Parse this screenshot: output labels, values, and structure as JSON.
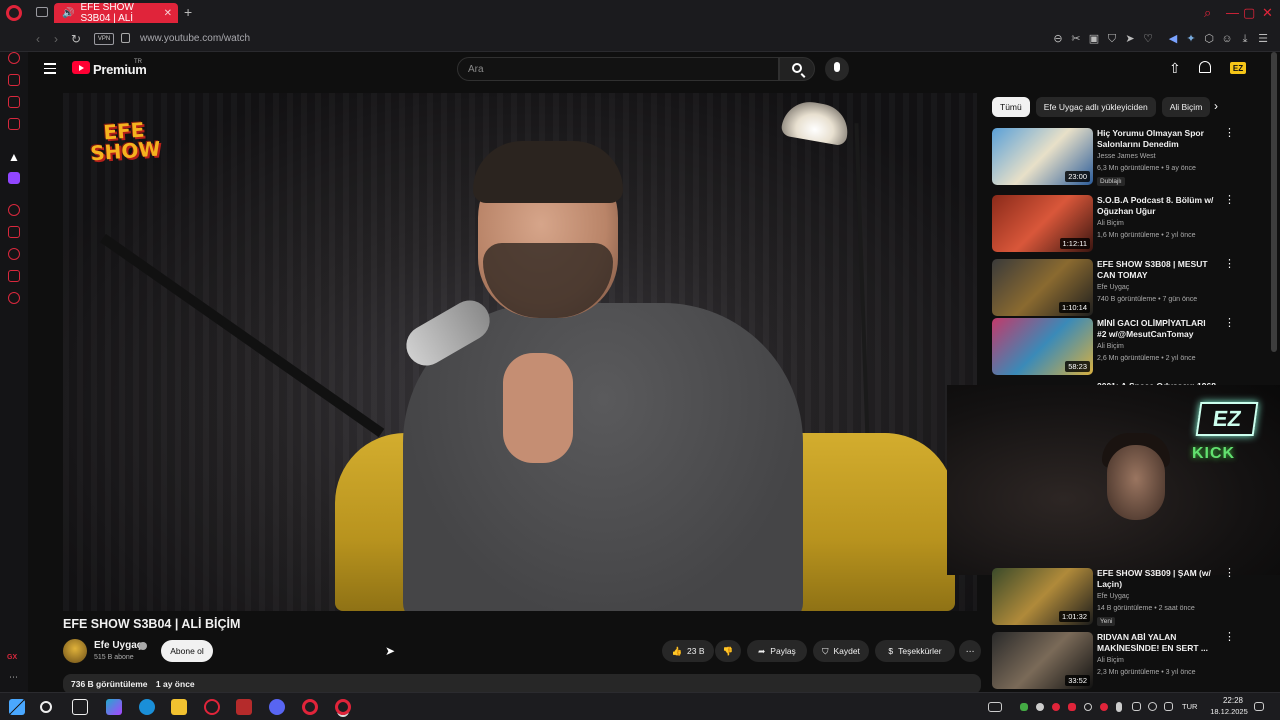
{
  "browser": {
    "tab_title": "EFE SHOW S3B04 | ALİ",
    "url": "www.youtube.com/watch",
    "vpn_label": "VPN",
    "accent": "#e0243a"
  },
  "youtube": {
    "logo_label": "Premium",
    "region_label": "TR",
    "search_placeholder": "Ara"
  },
  "video": {
    "overlay_logo": "EFE SHOW",
    "title": "EFE SHOW S3B04 | ALİ BİÇİM",
    "channel": "Efe Uygaç",
    "subscribers": "515 B abone",
    "subscribe_label": "Abone ol",
    "likes": "23 B",
    "share_label": "Paylaş",
    "save_label": "Kaydet",
    "thanks_label": "Teşekkürler",
    "views": "736 B görüntüleme",
    "age": "1 ay önce"
  },
  "chips": [
    "Tümü",
    "Efe Uygaç adlı yükleyiciden",
    "Ali Biçim"
  ],
  "recommendations": [
    {
      "title": "Hiç Yorumu Olmayan Spor Salonlarını Denedim",
      "channel": "Jesse James West",
      "meta": "6,3 Mn görüntüleme • 9 ay önce",
      "duration": "23:00",
      "badge": "Dublajlı"
    },
    {
      "title": "S.O.B.A Podcast 8. Bölüm w/ Oğuzhan Uğur",
      "channel": "Ali Biçim",
      "meta": "1,6 Mn görüntüleme • 2 yıl önce",
      "duration": "1:12:11",
      "badge": ""
    },
    {
      "title": "EFE SHOW S3B08 | MESUT CAN TOMAY",
      "channel": "Efe Uygaç",
      "meta": "740 B görüntüleme • 7 gün önce",
      "duration": "1:10:14",
      "badge": ""
    },
    {
      "title": "MİNİ GACI OLİMPİYATLARI #2 w/@MesutCanTomay",
      "channel": "Ali Biçim",
      "meta": "2,6 Mn görüntüleme • 2 yıl önce",
      "duration": "58:23",
      "badge": ""
    },
    {
      "title": "2001: A Space Odyssey: 1968",
      "channel": "",
      "meta": "",
      "duration": "",
      "badge": ""
    },
    {
      "title": "EFE SHOW S3B09 | ŞAM (w/ Laçin)",
      "channel": "Efe Uygaç",
      "meta": "14 B görüntüleme • 2 saat önce",
      "duration": "1:01:32",
      "badge": "Yeni"
    },
    {
      "title": "RIDVAN ABİ YALAN MAKİNESİNDE! EN SERT ...",
      "channel": "Ali Biçim",
      "meta": "2,3 Mn görüntüleme • 3 yıl önce",
      "duration": "33:52",
      "badge": ""
    }
  ],
  "webcam": {
    "logo": "EZ",
    "label": "KICK"
  },
  "taskbar": {
    "time": "22:28",
    "date": "18.12.2025",
    "lang": "TUR"
  }
}
